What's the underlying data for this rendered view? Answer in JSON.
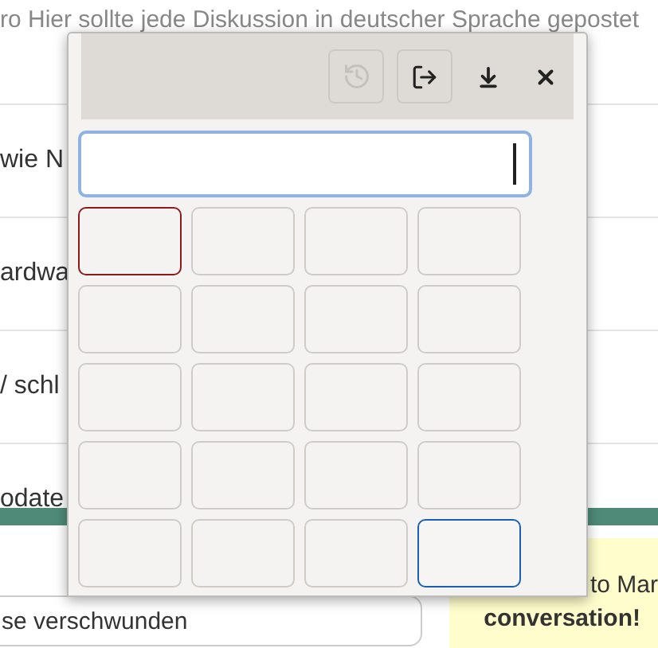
{
  "page": {
    "intro": "ro Hier sollte jede Diskussion in deutscher Sprache gepostet",
    "rows": [
      "wie N",
      "ardwa",
      "/ schl",
      "odate"
    ],
    "reply_field": {
      "value": "se verschwunden"
    },
    "welcome": {
      "text": "to Mar",
      "bold": "conversation!"
    }
  },
  "popup": {
    "toolbar": [
      {
        "kind": "history",
        "disabled": true
      },
      {
        "kind": "export",
        "disabled": false
      },
      {
        "kind": "download",
        "disabled": false
      },
      {
        "kind": "close",
        "disabled": false
      }
    ],
    "keys": [
      {
        "error": true,
        "focused": false
      },
      {
        "error": false,
        "focused": false
      },
      {
        "error": false,
        "focused": false
      },
      {
        "error": false,
        "focused": false
      },
      {
        "error": false,
        "focused": false
      },
      {
        "error": false,
        "focused": false
      },
      {
        "error": false,
        "focused": false
      },
      {
        "error": false,
        "focused": false
      },
      {
        "error": false,
        "focused": false
      },
      {
        "error": false,
        "focused": false
      },
      {
        "error": false,
        "focused": false
      },
      {
        "error": false,
        "focused": false
      },
      {
        "error": false,
        "focused": false
      },
      {
        "error": false,
        "focused": false
      },
      {
        "error": false,
        "focused": false
      },
      {
        "error": false,
        "focused": false
      },
      {
        "error": false,
        "focused": false
      },
      {
        "error": false,
        "focused": false
      },
      {
        "error": false,
        "focused": false
      },
      {
        "error": false,
        "focused": true
      }
    ]
  }
}
